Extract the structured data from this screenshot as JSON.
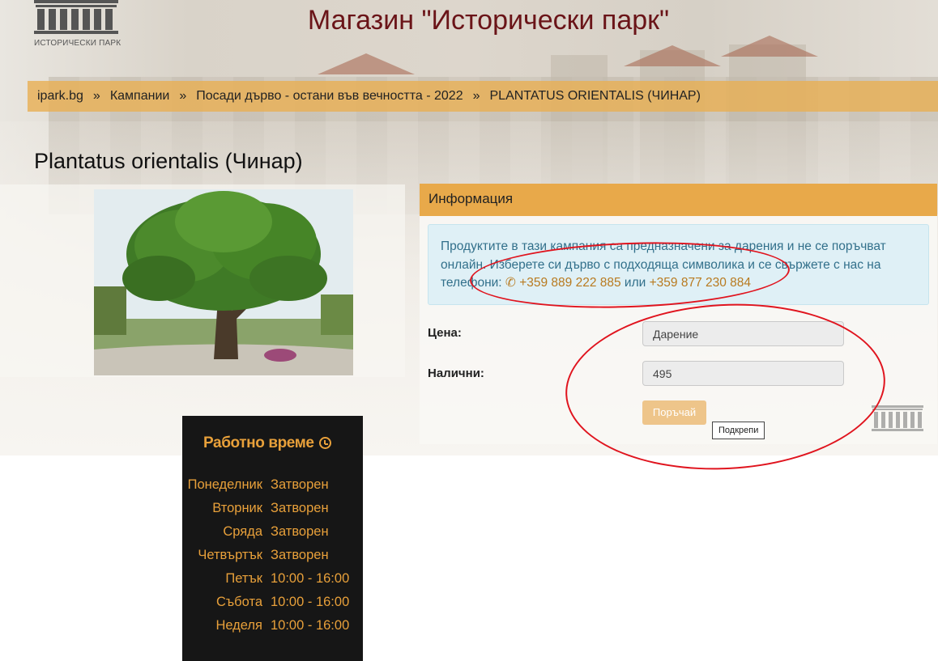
{
  "header": {
    "logo_text": "ИСТОРИЧЕСКИ ПАРК",
    "site_title": "Магазин \"Исторически парк\""
  },
  "breadcrumb": [
    {
      "label": "ipark.bg"
    },
    {
      "label": "Кампании"
    },
    {
      "label": "Посади дърво - остани във вечността - 2022"
    },
    {
      "label": "PLANTATUS ORIENTALIS (ЧИНАР)"
    }
  ],
  "breadcrumb_separator": "»",
  "product": {
    "title": "Plantatus orientalis (Чинар)"
  },
  "info": {
    "heading": "Информация",
    "alert_text": "Продуктите в тази кампания са предназначени за дарения и не се поръчват онлайн. Изберете си дърво с подходяща символика и се свържете с нас на телефони: ",
    "phone1": "+359 889 222 885",
    "or_text": " или ",
    "phone2": "+359 877 230 884",
    "price_label": "Цена:",
    "price_value": "Дарение",
    "available_label": "Налични:",
    "available_value": "495",
    "order_button": "Поръчай",
    "tooltip": "Подкрепи"
  },
  "hours": {
    "title": "Работно време",
    "rows": [
      {
        "day": "Понеделник",
        "time": "Затворен"
      },
      {
        "day": "Вторник",
        "time": "Затворен"
      },
      {
        "day": "Сряда",
        "time": "Затворен"
      },
      {
        "day": "Четвъртък",
        "time": "Затворен"
      },
      {
        "day": "Петък",
        "time": "10:00 - 16:00"
      },
      {
        "day": "Събота",
        "time": "10:00 - 16:00"
      },
      {
        "day": "Неделя",
        "time": "10:00 - 16:00"
      }
    ]
  },
  "colors": {
    "accent": "#e8a94a",
    "title_red": "#6a1418",
    "annotation_red": "#e0141e",
    "hours_bg": "#161616",
    "hours_text": "#e8a03a"
  }
}
